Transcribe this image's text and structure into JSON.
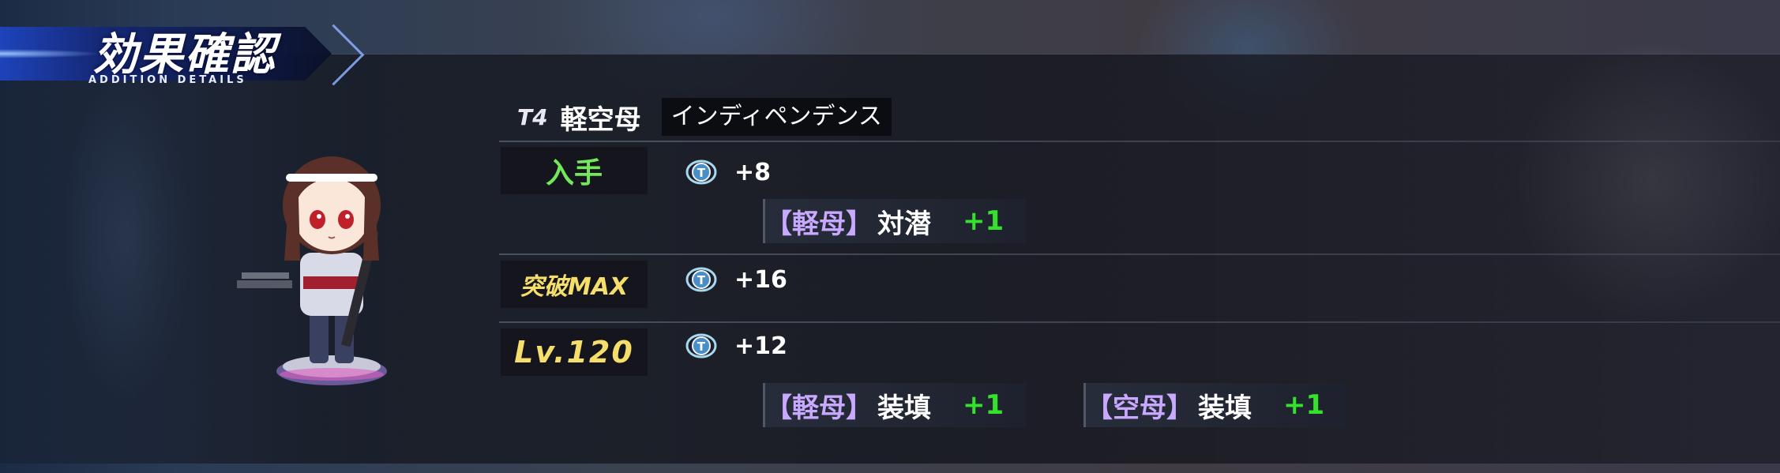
{
  "header": {
    "title": "効果確認",
    "subtitle": "ADDITION DETAILS"
  },
  "ship": {
    "tier": "T4",
    "type": "軽空母",
    "name": "インディペンデンス"
  },
  "rows": [
    {
      "tag": "入手",
      "tech_points": "+8",
      "bonuses": [
        {
          "type": "軽母",
          "stat": "対潜",
          "value": "+1"
        }
      ]
    },
    {
      "tag": "突破MAX",
      "tech_points": "+16",
      "bonuses": []
    },
    {
      "tag": "Lv.120",
      "tech_points": "+12",
      "bonuses": [
        {
          "type": "軽母",
          "stat": "装填",
          "value": "+1"
        },
        {
          "type": "空母",
          "stat": "装填",
          "value": "+1"
        }
      ]
    }
  ],
  "brackets": {
    "open": "【",
    "close": "】"
  },
  "icons": {
    "tech_point": "tech-point-icon",
    "character": "character-portrait"
  },
  "colors": {
    "obtain_tag": "#72e85a",
    "limit_tag": "#f5de6a",
    "bonus_type": "#c9a8ff",
    "bonus_value": "#34e22c"
  }
}
